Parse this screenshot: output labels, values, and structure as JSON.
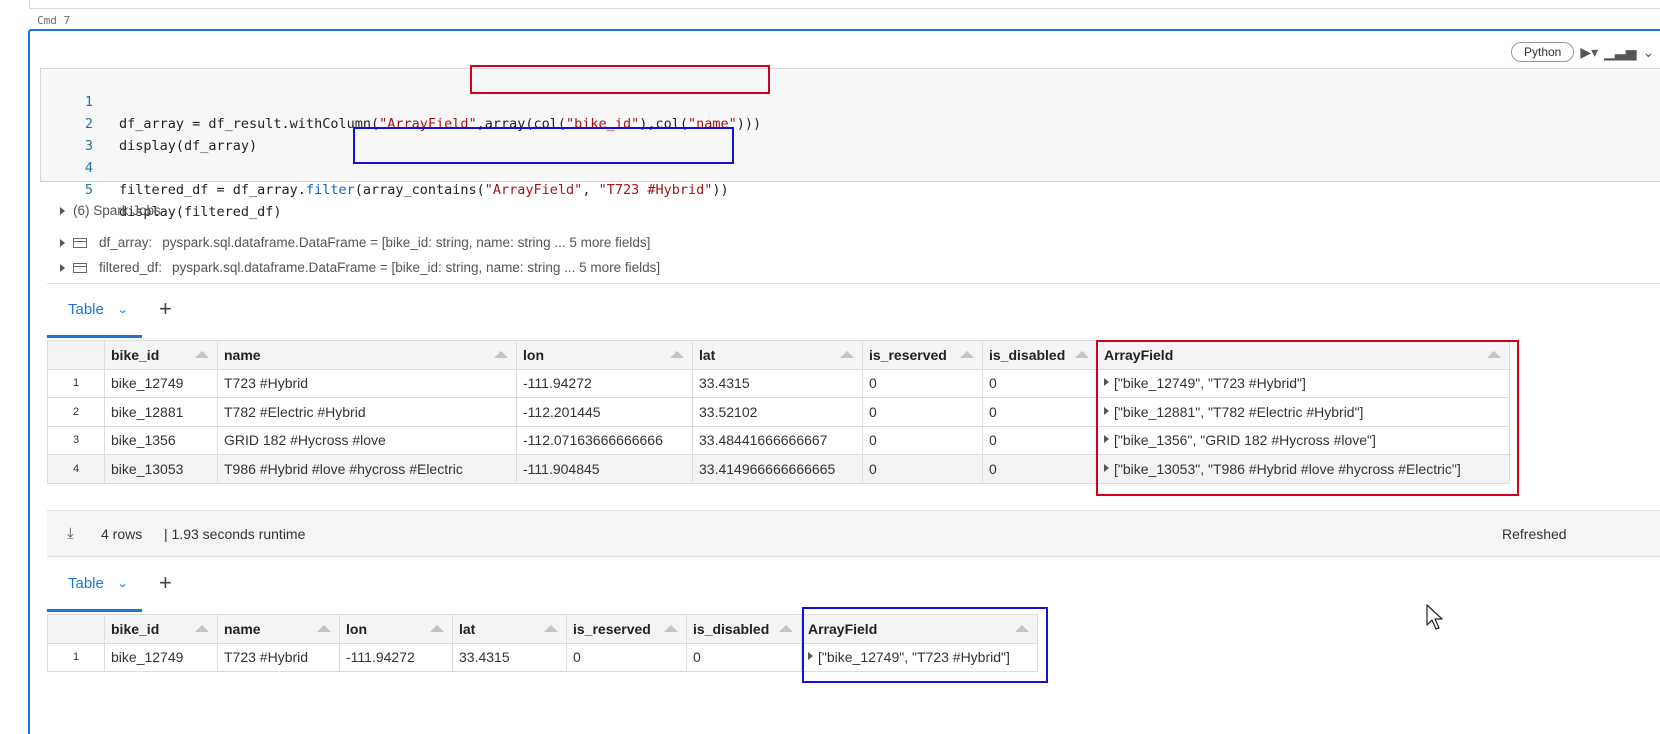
{
  "cell": {
    "label": "Cmd 7",
    "language": "Python",
    "code_lines": [
      {
        "num": "1"
      },
      {
        "num": "2"
      },
      {
        "num": "3"
      },
      {
        "num": "4"
      },
      {
        "num": "5"
      }
    ]
  },
  "code": {
    "l1_a": "df_array = df_result.withColumn(",
    "l1_s1": "\"ArrayField\"",
    "l1_b": ",array(col(",
    "l1_s2": "\"bike_id\"",
    "l1_c": "),col(",
    "l1_s3": "\"name\"",
    "l1_d": ")))",
    "l2": "display(df_array)",
    "l4_a": "filtered_df = df_array.",
    "l4_fn": "filter",
    "l4_b": "(array_contains(",
    "l4_s1": "\"ArrayField\"",
    "l4_c": ", ",
    "l4_s2": "\"T723 #Hybrid\"",
    "l4_d": "))",
    "l5": "display(filtered_df)"
  },
  "output": {
    "spark_jobs": "(6) Spark Jobs",
    "dataframes": [
      {
        "name": "df_array:",
        "schema": "pyspark.sql.dataframe.DataFrame = [bike_id: string, name: string ... 5 more fields]"
      },
      {
        "name": "filtered_df:",
        "schema": "pyspark.sql.dataframe.DataFrame = [bike_id: string, name: string ... 5 more fields]"
      }
    ]
  },
  "tabs": {
    "label": "Table",
    "add": "+"
  },
  "columns": [
    "bike_id",
    "name",
    "lon",
    "lat",
    "is_reserved",
    "is_disabled",
    "ArrayField"
  ],
  "table1": {
    "rows": [
      {
        "n": "1",
        "bike_id": "bike_12749",
        "name": "T723 #Hybrid",
        "lon": "-111.94272",
        "lat": "33.4315",
        "is_reserved": "0",
        "is_disabled": "0",
        "array": "[\"bike_12749\", \"T723 #Hybrid\"]"
      },
      {
        "n": "2",
        "bike_id": "bike_12881",
        "name": "T782 #Electric #Hybrid",
        "lon": "-112.201445",
        "lat": "33.52102",
        "is_reserved": "0",
        "is_disabled": "0",
        "array": "[\"bike_12881\", \"T782 #Electric #Hybrid\"]"
      },
      {
        "n": "3",
        "bike_id": "bike_1356",
        "name": "GRID 182 #Hycross #love",
        "lon": "-112.07163666666666",
        "lat": "33.48441666666667",
        "is_reserved": "0",
        "is_disabled": "0",
        "array": "[\"bike_1356\", \"GRID 182 #Hycross #love\"]"
      },
      {
        "n": "4",
        "bike_id": "bike_13053",
        "name": "T986 #Hybrid #love #hycross #Electric",
        "lon": "-111.904845",
        "lat": "33.414966666666665",
        "is_reserved": "0",
        "is_disabled": "0",
        "array": "[\"bike_13053\", \"T986 #Hybrid #love #hycross #Electric\"]"
      }
    ]
  },
  "footer": {
    "rows": "4 rows",
    "runtime": "|  1.93 seconds runtime",
    "refreshed": "Refreshed"
  },
  "table2": {
    "rows": [
      {
        "n": "1",
        "bike_id": "bike_12749",
        "name": "T723 #Hybrid",
        "lon": "-111.94272",
        "lat": "33.4315",
        "is_reserved": "0",
        "is_disabled": "0",
        "array": "[\"bike_12749\", \"T723 #Hybrid\"]"
      }
    ]
  },
  "colors": {
    "accent": "#1f76d2",
    "highlight_red": "#d0021b",
    "highlight_blue": "#1010e0",
    "string": "#a31515",
    "function": "#0a6ac4"
  }
}
